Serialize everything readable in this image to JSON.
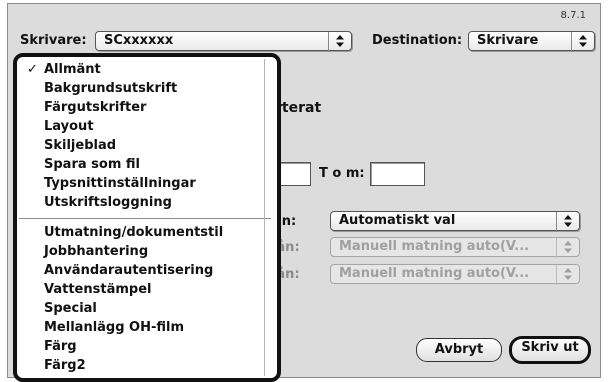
{
  "version": "8.7.1",
  "printer": {
    "label": "Skrivare:",
    "value": "SCxxxxxx"
  },
  "destination": {
    "label": "Destination:",
    "value": "Skrivare"
  },
  "menu": {
    "group1": [
      {
        "label": "Allmänt",
        "checked": true
      },
      {
        "label": "Bakgrundsutskrift"
      },
      {
        "label": "Färgutskrifter"
      },
      {
        "label": "Layout"
      },
      {
        "label": "Skiljeblad"
      },
      {
        "label": "Spara som fil"
      },
      {
        "label": "Typsnittinställningar"
      },
      {
        "label": "Utskriftsloggning"
      }
    ],
    "group2": [
      {
        "label": "Utmatning/dokumentstil"
      },
      {
        "label": "Jobbhantering"
      },
      {
        "label": "Användarautentisering"
      },
      {
        "label": "Vattenstämpel"
      },
      {
        "label": "Special"
      },
      {
        "label": "Mellanlägg OH-film"
      },
      {
        "label": "Färg"
      },
      {
        "label": "Färg2"
      }
    ]
  },
  "panel": {
    "partial_label": "rterat",
    "to_label": "T o m:",
    "source1": {
      "label": "ån:",
      "value": "Automatiskt val"
    },
    "source2": {
      "label": "rån:",
      "value": "Manuell matning auto(V..."
    },
    "source3": {
      "label": "rån:",
      "value": "Manuell matning auto(V..."
    }
  },
  "buttons": {
    "cancel": "Avbryt",
    "print": "Skriv ut"
  },
  "icons": {
    "check": "check-icon",
    "popup_arrows": "updown-arrows-icon"
  }
}
